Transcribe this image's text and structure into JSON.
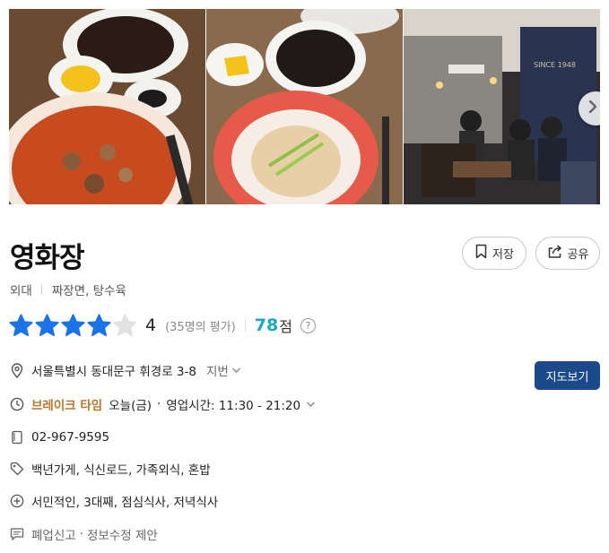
{
  "place": {
    "name": "영화장",
    "area": "외대",
    "categories": "짜장면, 탕수육"
  },
  "photos": {
    "items": [
      {
        "description": "jjamppong and jjajangmyeon"
      },
      {
        "description": "jjajang with cucumber noodles"
      },
      {
        "description": "restaurant interior with diners"
      }
    ],
    "next_icon": "chevron-right-icon"
  },
  "actions": {
    "save_label": "저장",
    "share_label": "공유",
    "map_label": "지도보기"
  },
  "rating": {
    "stars_filled": 4,
    "stars_total": 5,
    "score": "4",
    "review_count_text": "(35명의 평가)",
    "points": "78",
    "points_unit": "점",
    "help_symbol": "?"
  },
  "info": {
    "address": "서울특별시 동대문구 휘경로 3-8",
    "address_toggle": "지번",
    "break_time_label": "브레이크 타임",
    "today": "오늘(금)",
    "hours": "영업시간: 11:30 - 21:20",
    "phone": "02-967-9595",
    "tags": "백년가게, 식신로드, 가족외식, 혼밥",
    "keywords": "서민적인, 3대째, 점심식사, 저녁식사",
    "report_closed": "폐업신고",
    "report_edit": "정보수정 제안",
    "separator": "·"
  },
  "colors": {
    "star_filled": "#1a73e8",
    "star_empty": "#e2e2e2",
    "points": "#1aa7c4",
    "break_time": "#b8772c",
    "map_button": "#1a4a8a"
  }
}
